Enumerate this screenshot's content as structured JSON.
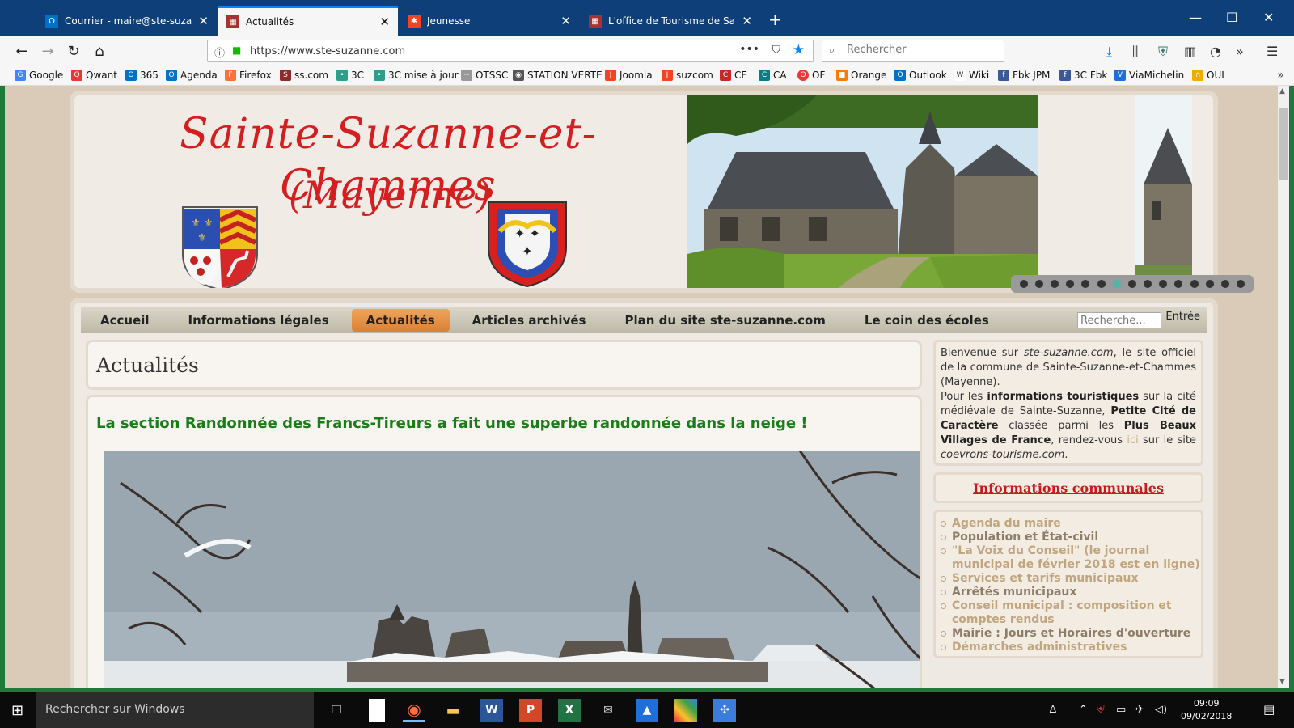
{
  "browser": {
    "tabs": [
      {
        "title": "Courrier - maire@ste-suzanne.",
        "icon": "outlook-icon",
        "active": false
      },
      {
        "title": "Actualités",
        "icon": "site-favicon-icon",
        "active": true
      },
      {
        "title": "Jeunesse",
        "icon": "joomla-icon",
        "active": false
      },
      {
        "title": "L'office de Tourisme de Sainte-",
        "icon": "site-favicon-icon",
        "active": false
      }
    ],
    "new_tab": "+",
    "url": "https://www.ste-suzanne.com",
    "search_placeholder": "Rechercher",
    "bookmarks": [
      {
        "label": "Google",
        "icon": "G",
        "color": "#4285f4"
      },
      {
        "label": "Qwant",
        "icon": "Q",
        "color": "#e53935"
      },
      {
        "label": "365",
        "icon": "O",
        "color": "#0072c6"
      },
      {
        "label": "Agenda",
        "icon": "O",
        "color": "#0072c6"
      },
      {
        "label": "Firefox",
        "icon": "F",
        "color": "#ff7139"
      },
      {
        "label": "ss.com",
        "icon": "S",
        "color": "#8e2a2a"
      },
      {
        "label": "3C",
        "icon": "•",
        "color": "#2e9e8a"
      },
      {
        "label": "3C mise à jour",
        "icon": "•",
        "color": "#2e9e8a"
      },
      {
        "label": "OTSSC",
        "icon": "~",
        "color": "#999999"
      },
      {
        "label": "STATION VERTE",
        "icon": "◉",
        "color": "#555555"
      },
      {
        "label": "Joomla",
        "icon": "J",
        "color": "#f44321"
      },
      {
        "label": "suzcom",
        "icon": "J",
        "color": "#f44321"
      },
      {
        "label": "CE",
        "icon": "C",
        "color": "#c62828"
      },
      {
        "label": "CA",
        "icon": "C",
        "color": "#0b7b8a"
      },
      {
        "label": "OF",
        "icon": "O",
        "color": "#e53935"
      },
      {
        "label": "Orange",
        "icon": "■",
        "color": "#ff7900"
      },
      {
        "label": "Outlook",
        "icon": "O",
        "color": "#0072c6"
      },
      {
        "label": "Wiki",
        "icon": "W",
        "color": "#333333"
      },
      {
        "label": "Fbk JPM",
        "icon": "f",
        "color": "#3b5998"
      },
      {
        "label": "3C Fbk",
        "icon": "f",
        "color": "#3b5998"
      },
      {
        "label": "ViaMichelin",
        "icon": "V",
        "color": "#1e6fd9"
      },
      {
        "label": "OUI",
        "icon": "∩",
        "color": "#f2a900"
      }
    ]
  },
  "site": {
    "title": "Sainte-Suzanne-et-Chammes",
    "subtitle": "(Mayenne)",
    "menu": [
      "Accueil",
      "Informations légales",
      "Actualités",
      "Articles archivés",
      "Plan du site ste-suzanne.com",
      "Le coin des écoles"
    ],
    "menu_active_index": 2,
    "search_placeholder": "Recherche...",
    "search_button": "Entrée",
    "page_title": "Actualités",
    "article_title": "La section Randonnée des Francs-Tireurs a fait une superbe randonnée dans la neige !",
    "slideshow_active_dot": 6,
    "welcome": {
      "p1": "Bienvenue sur ",
      "site_it": "ste-suzanne.com",
      "p2": ", le site officiel de la commune de Sainte-Suzanne-et-Chammes (Mayenne).",
      "p3": "Pour les ",
      "b1": "informations touristiques",
      "p4": " sur la cité médiévale de Sainte-Suzanne, ",
      "b2": "Petite Cité de Caractère",
      "p5": " classée parmi les ",
      "b3": "Plus Beaux Villages de France",
      "p6": ", rendez-vous ",
      "link": "ici",
      "p7": " sur le site ",
      "site2_it": "coevrons-tourisme.com",
      "p8": "."
    },
    "info_heading": "Informations communales",
    "info_links": [
      "Agenda du maire",
      "Population et État-civil",
      "\"La Voix du Conseil\" (le journal municipal de février 2018 est en ligne)",
      "Services et tarifs municipaux",
      "Arrêtés municipaux",
      "Conseil municipal : composition et comptes rendus",
      "Mairie : Jours et Horaires d'ouverture",
      "Démarches administratives"
    ]
  },
  "taskbar": {
    "search_placeholder": "Rechercher sur Windows",
    "time": "09:09",
    "date": "09/02/2018"
  },
  "colors": {
    "title_red": "#d31f1f",
    "article_green": "#1a7d1a",
    "menu_active": "#e6924a"
  }
}
